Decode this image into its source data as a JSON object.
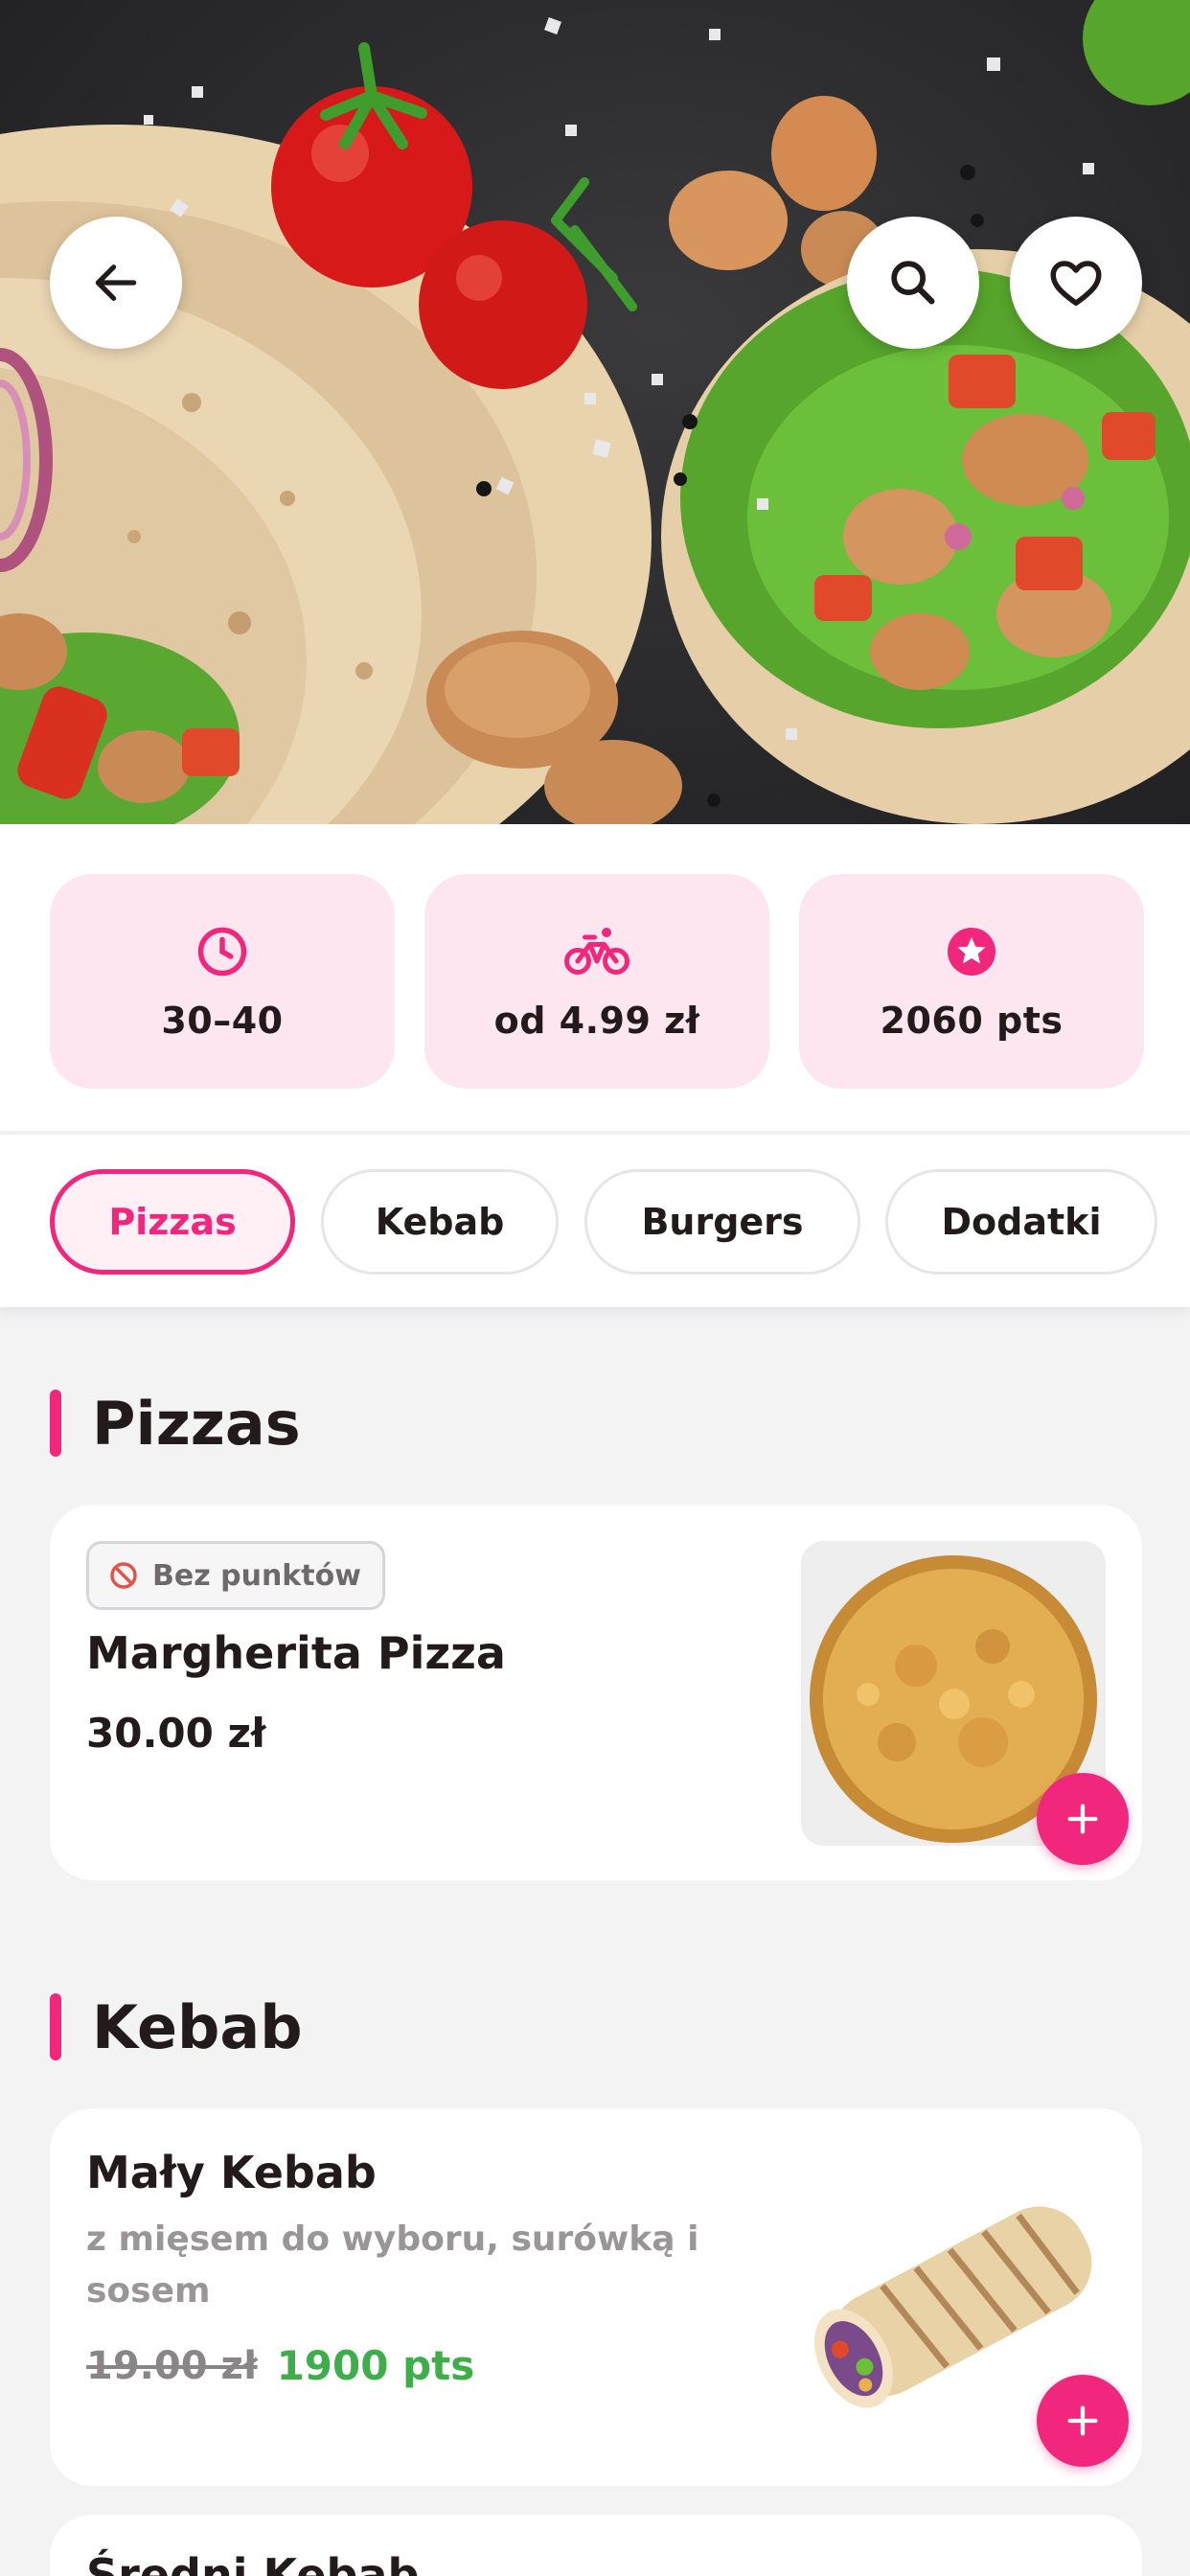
{
  "hero": {
    "back_icon": "arrow-left-icon",
    "search_icon": "search-icon",
    "favorite_icon": "heart-icon"
  },
  "info": {
    "delivery_time": "30–40",
    "delivery_fee": "od 4.99 zł",
    "points": "2060 pts",
    "icons": [
      "clock-icon",
      "bike-icon",
      "star-icon"
    ]
  },
  "tabs": [
    "Pizzas",
    "Kebab",
    "Burgers",
    "Dodatki"
  ],
  "active_tab": "Pizzas",
  "sections": {
    "pizzas": {
      "title": "Pizzas",
      "items": [
        {
          "badge": "Bez punktów",
          "name": "Margherita Pizza",
          "price": "30.00 zł"
        }
      ]
    },
    "kebab": {
      "title": "Kebab",
      "items": [
        {
          "name": "Mały Kebab",
          "description": "z mięsem do wyboru, surówką i sosem",
          "old_price": "19.00 zł",
          "points_price": "1900 pts"
        },
        {
          "name": "Średni Kebab"
        }
      ]
    }
  },
  "colors": {
    "accent": "#f0277d",
    "card_pink": "#fde6ef",
    "points_green": "#3fae4a"
  }
}
